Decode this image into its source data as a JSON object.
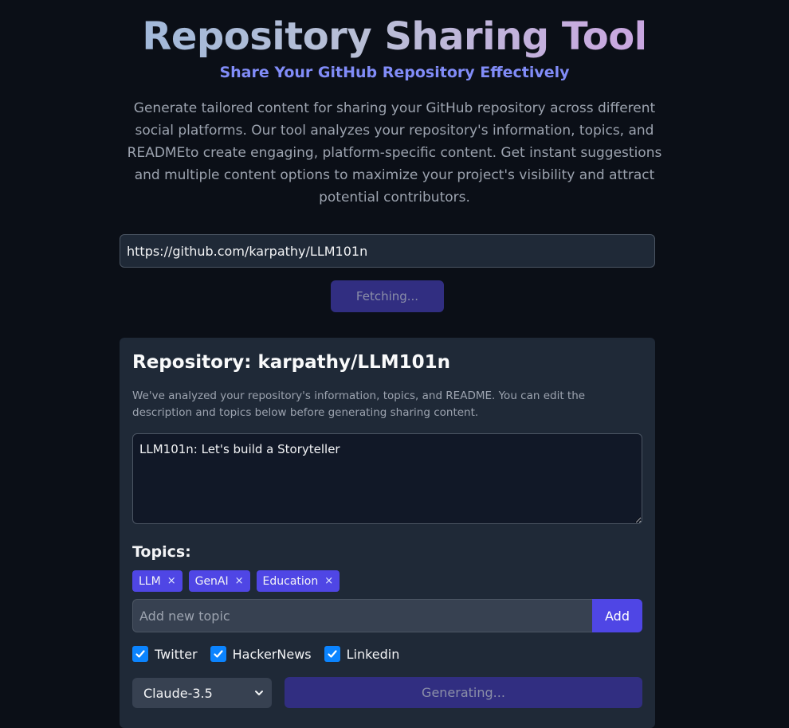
{
  "header": {
    "title": "Repository Sharing Tool",
    "subtitle": "Share Your GitHub Repository Effectively",
    "description": "Generate tailored content for sharing your GitHub repository across different social platforms. Our tool analyzes your repository's information, topics, and READMEto create engaging, platform-specific content. Get instant suggestions and multiple content options to maximize your project's visibility and attract potential contributors."
  },
  "url_input": {
    "value": "https://github.com/karpathy/LLM101n"
  },
  "fetch_button": {
    "label": "Fetching..."
  },
  "repo_panel": {
    "title": "Repository: karpathy/LLM101n",
    "note": "We've analyzed your repository's information, topics, and README. You can edit the description and topics below before generating sharing content.",
    "description_value": "LLM101n: Let's build a Storyteller",
    "topics_label": "Topics:",
    "topics": [
      {
        "label": "LLM",
        "remove": "×"
      },
      {
        "label": "GenAI",
        "remove": "×"
      },
      {
        "label": "Education",
        "remove": "×"
      }
    ],
    "topic_input_placeholder": "Add new topic",
    "add_label": "Add",
    "platforms": [
      {
        "label": "Twitter",
        "checked": true
      },
      {
        "label": "HackerNews",
        "checked": true
      },
      {
        "label": "Linkedin",
        "checked": true
      }
    ],
    "model": "Claude-3.5",
    "generate_label": "Generating..."
  },
  "colors": {
    "background": "#0b0f17",
    "panel": "#1f2937",
    "accent": "#4f46e5",
    "disabled_button": "#312e81",
    "checkbox": "#0b84ff",
    "subtitle": "#818cf8"
  },
  "icons": {
    "checkbox": "checkmark-icon",
    "select": "chevron-down-icon",
    "chip_remove": "close-icon"
  }
}
